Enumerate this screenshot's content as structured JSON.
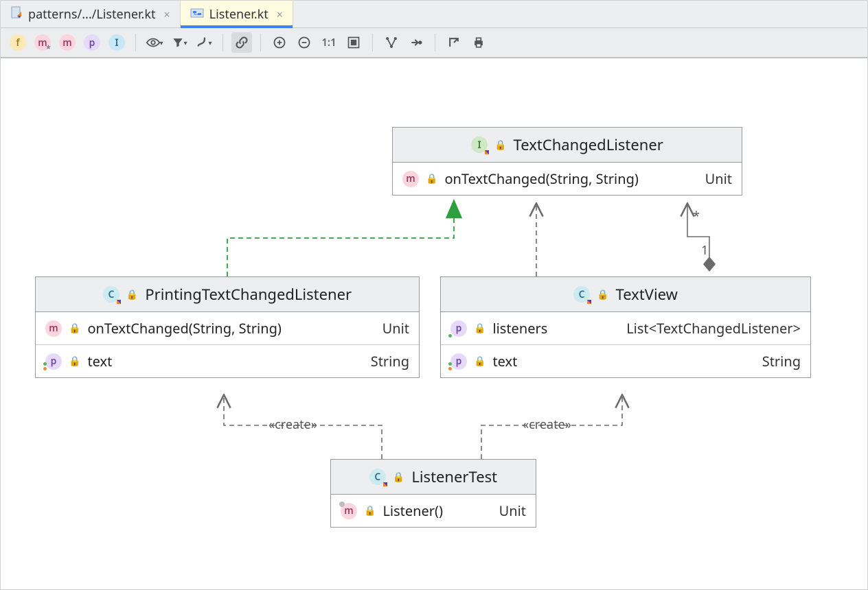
{
  "tabs": [
    {
      "label": "patterns/.../Listener.kt",
      "active": false
    },
    {
      "label": "Listener.kt",
      "active": true
    }
  ],
  "toolbar": {
    "filters": [
      "f",
      "m",
      "m",
      "p",
      "I"
    ]
  },
  "classes": {
    "textChangedListener": {
      "name": "TextChangedListener",
      "icon": "interface",
      "members": [
        {
          "kind": "m",
          "name": "onTextChanged(String, String)",
          "type": "Unit"
        }
      ]
    },
    "printingTextChangedListener": {
      "name": "PrintingTextChangedListener",
      "icon": "class",
      "members": [
        {
          "kind": "m",
          "name": "onTextChanged(String, String)",
          "type": "Unit"
        },
        {
          "kind": "p",
          "name": "text",
          "type": "String"
        }
      ]
    },
    "textView": {
      "name": "TextView",
      "icon": "class",
      "members": [
        {
          "kind": "p",
          "name": "listeners",
          "type": "List<TextChangedListener>"
        },
        {
          "kind": "p",
          "name": "text",
          "type": "String"
        }
      ]
    },
    "listenerTest": {
      "name": "ListenerTest",
      "icon": "class",
      "members": [
        {
          "kind": "m",
          "name": "Listener()",
          "type": "Unit"
        }
      ]
    }
  },
  "relations": {
    "createLabel": "«create»",
    "multiplicity": {
      "many": "*",
      "one": "1"
    }
  }
}
